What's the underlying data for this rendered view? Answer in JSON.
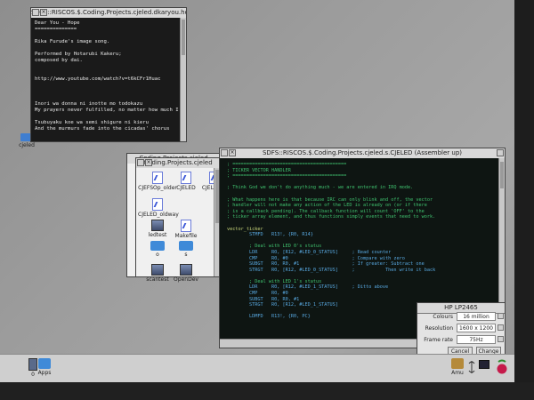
{
  "text_window": {
    "title": "SDFS::RISCOS.$.Coding.Projects.cjeled.dkaryou.hope (Text ua)",
    "lines": [
      "Dear You - Hope",
      "==============",
      "",
      "Rika Furude's image song.",
      "",
      "Performed by Hotarubi Kakeru;",
      "composed by dai.",
      "",
      "",
      "http://www.youtube.com/watch?v=t6kCFr1Huac",
      "",
      "",
      "",
      "Inori wa donna ni inotte mo todokazu",
      "My prayers never fulfilled, no matter how much I pray",
      "",
      "Tsubuyaku koe wa semi shigure ni kieru",
      "And the murmurs fade into the cicadas' chorus"
    ]
  },
  "desktop_icon": {
    "label": "cjeled"
  },
  "folder_window_1": {
    "title": "Coding.Projects.cjeled"
  },
  "folder_window_2": {
    "title": "Coding.Projects.cjeled",
    "files": [
      {
        "label": "CJEFSOp_older",
        "kind": "file"
      },
      {
        "label": "CJELED",
        "kind": "file"
      },
      {
        "label": "CJELED_2",
        "kind": "file"
      },
      {
        "label": "CJELED_oldway",
        "kind": "file"
      },
      {
        "label": "ledtest",
        "kind": "app"
      },
      {
        "label": "Makefile",
        "kind": "file"
      },
      {
        "label": "o",
        "kind": "dir"
      },
      {
        "label": "s",
        "kind": "dir"
      },
      {
        "label": "scantest",
        "kind": "app"
      },
      {
        "label": "OpenDev",
        "kind": "app"
      }
    ]
  },
  "asm_window": {
    "title": "SDFS::RISCOS.$.Coding.Projects.cjeled.s.CJELED (Assembler up)",
    "lines": [
      {
        "t": "; =========================================",
        "c": "comment"
      },
      {
        "t": "; TICKER VECTOR HANDLER",
        "c": "comment"
      },
      {
        "t": "; =========================================",
        "c": "comment"
      },
      {
        "t": "",
        "c": "dir"
      },
      {
        "t": "; Think God we don't do anything much - we are entered in IRQ mode.",
        "c": "comment"
      },
      {
        "t": "",
        "c": "dir"
      },
      {
        "t": "; What happens here is that because IRC can only blink and off, the vector",
        "c": "comment"
      },
      {
        "t": "; handler will not make any action of the LED is already on (or if there",
        "c": "comment"
      },
      {
        "t": "; is a callback pending). The callback function will count 'OFF' to the",
        "c": "comment"
      },
      {
        "t": "; ticker array element, and thus functions simply events that need to work.",
        "c": "comment"
      },
      {
        "t": "",
        "c": "dir"
      },
      {
        "t": "vector_ticker",
        "c": "label"
      },
      {
        "t": "        STMFD   R13!, {R0, R14}",
        "c": "instr"
      },
      {
        "t": "",
        "c": "dir"
      },
      {
        "t": "        ; Deal with LED 0's status",
        "c": "comment"
      },
      {
        "t": "        LDR     R0, [R12, #LED_0_STATUS]     ; Read counter",
        "c": "instr"
      },
      {
        "t": "        CMP     R0, #0                       ; Compare with zero",
        "c": "instr"
      },
      {
        "t": "        SUBGT   R0, R0, #1                   ; If greater: Subtract one",
        "c": "instr"
      },
      {
        "t": "        STRGT   R0, [R12, #LED_0_STATUS]     ;           Then write it back",
        "c": "instr"
      },
      {
        "t": "",
        "c": "dir"
      },
      {
        "t": "        ; Deal with LED 1's status",
        "c": "comment"
      },
      {
        "t": "        LDR     R0, [R12, #LED_1_STATUS]     ; Ditto above",
        "c": "instr"
      },
      {
        "t": "        CMP     R0, #0",
        "c": "instr"
      },
      {
        "t": "        SUBGT   R0, R0, #1",
        "c": "instr"
      },
      {
        "t": "        STRGT   R0, [R12, #LED_1_STATUS]",
        "c": "instr"
      },
      {
        "t": "",
        "c": "dir"
      },
      {
        "t": "        LDMFD   R13!, {R0, PC}",
        "c": "instr"
      },
      {
        "t": "",
        "c": "dir"
      }
    ]
  },
  "display_dialog": {
    "title": "HP LP2465",
    "rows": [
      {
        "label": "Colours",
        "value": "16 million"
      },
      {
        "label": "Resolution",
        "value": "1600 x 1200"
      },
      {
        "label": "Frame rate",
        "value": "75Hz"
      }
    ],
    "cancel_label": "Cancel",
    "change_label": "Change"
  },
  "iconbar": {
    "left": [
      {
        "label": "0"
      },
      {
        "label": "Apps"
      }
    ],
    "right": [
      {
        "label": "Amu"
      }
    ]
  }
}
